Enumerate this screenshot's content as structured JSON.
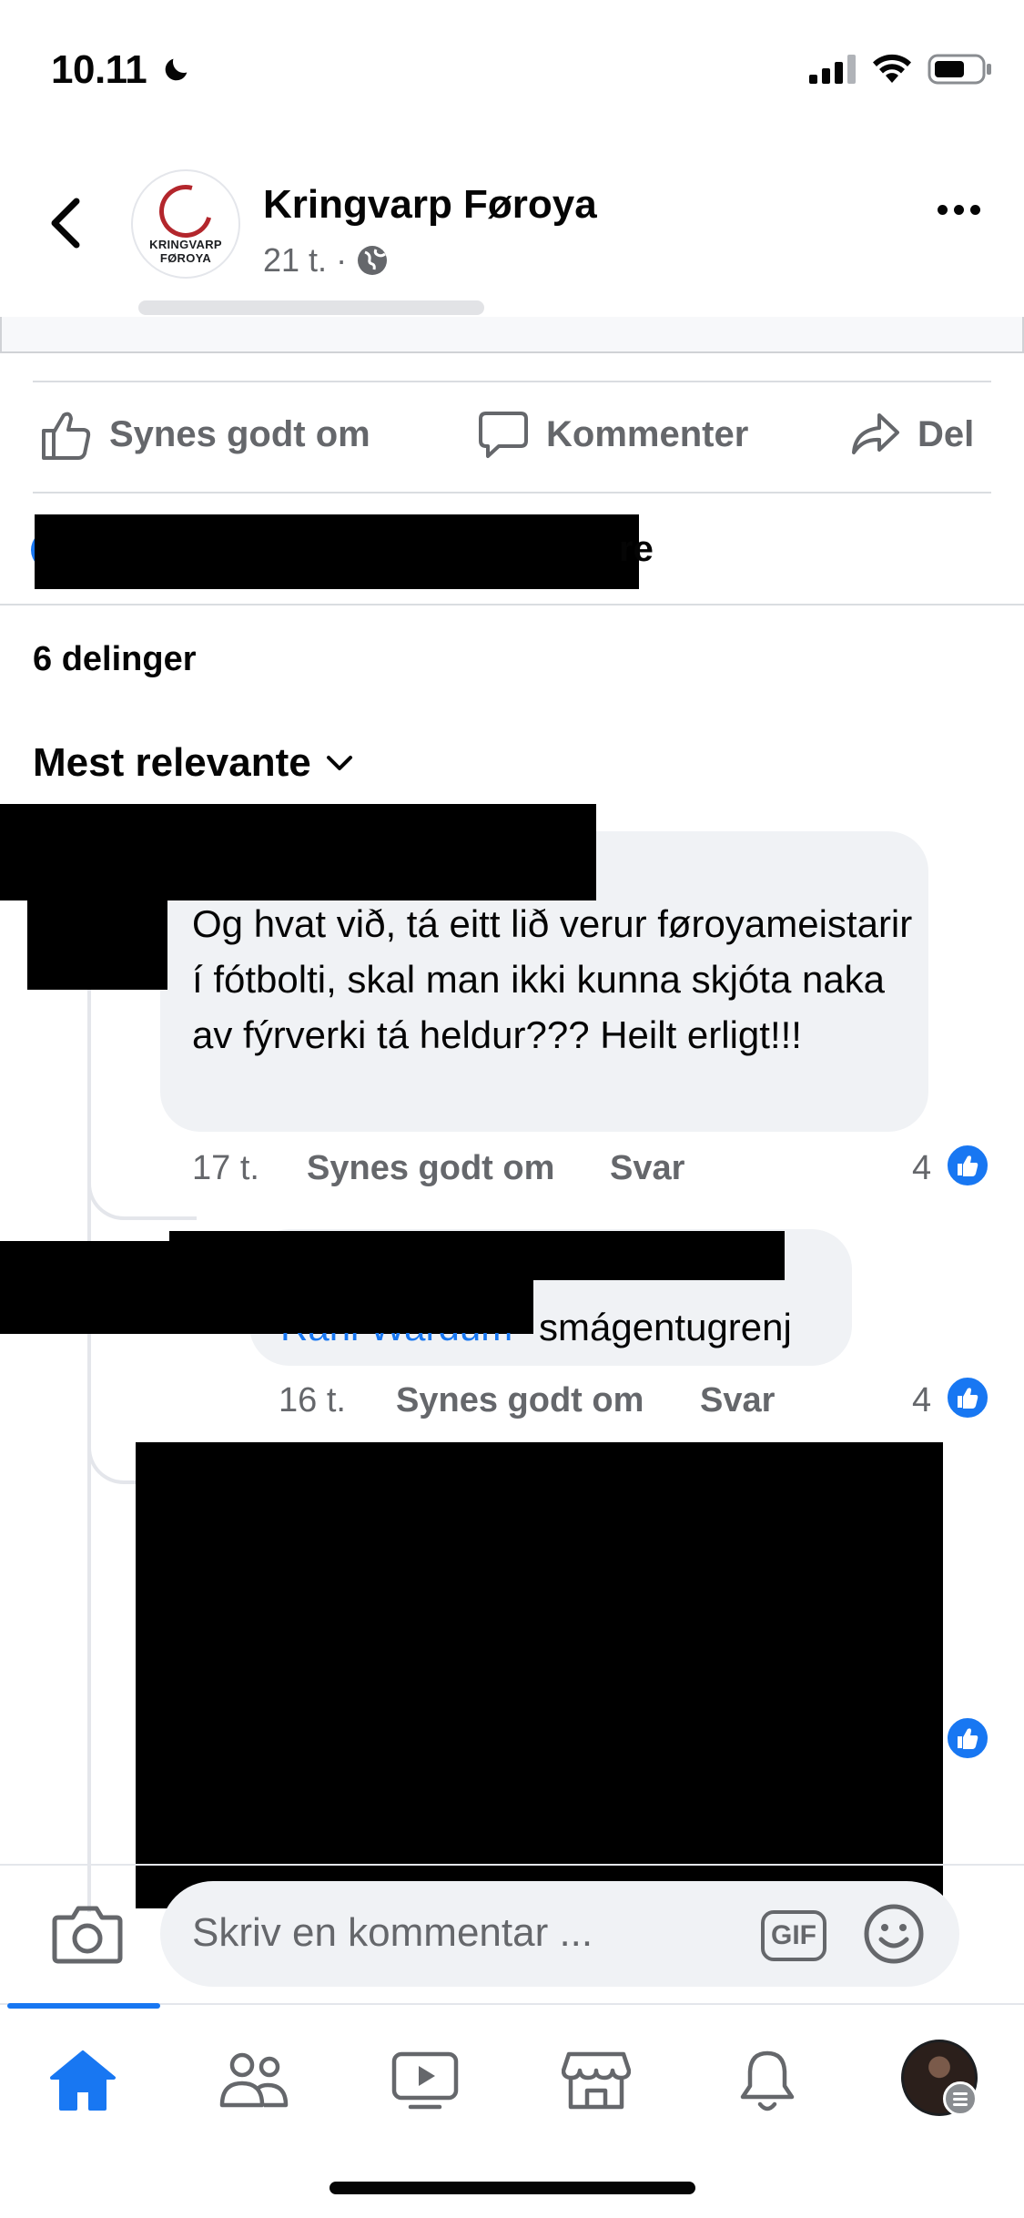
{
  "status_bar": {
    "time": "10.11",
    "icons": [
      "moon-icon",
      "cellular-signal-icon",
      "wifi-icon",
      "battery-icon"
    ]
  },
  "header": {
    "page_name": "Kringvarp Føroya",
    "timestamp": "21 t.",
    "separator": "·",
    "audience_icon": "globe-icon",
    "avatar_logo_line1": "KRINGVARP",
    "avatar_logo_line2": "FØROYA"
  },
  "actions": {
    "like_label": "Synes godt om",
    "comment_label": "Kommenter",
    "share_label": "Del"
  },
  "reactions": {
    "visible_tail": "re"
  },
  "shares": {
    "count_label": "6 delinger"
  },
  "comments": {
    "sort_label": "Mest relevante",
    "items": [
      {
        "text": "Og hvat við, tá eitt lið verur føroyameistarir í fótbolti, skal man ikki kunna skjóta naka av fýrverki tá heldur??? Heilt erligt!!!",
        "time": "17 t.",
        "like_label": "Synes godt om",
        "reply_label": "Svar",
        "like_count": "4"
      },
      {
        "mention": "Rani Wardum",
        "text": "smágentugrenj",
        "time": "16 t.",
        "like_label": "Synes godt om",
        "reply_label": "Svar",
        "like_count": "4"
      }
    ]
  },
  "composer": {
    "placeholder": "Skriv en kommentar ...",
    "gif_label": "GIF"
  },
  "tabbar": {
    "tabs": [
      "home-icon",
      "friends-icon",
      "watch-icon",
      "marketplace-icon",
      "notifications-icon",
      "profile-avatar"
    ],
    "active": "home"
  },
  "colors": {
    "accent": "#1877f2",
    "secondary_text": "#65676b",
    "bubble": "#f0f2f5"
  }
}
